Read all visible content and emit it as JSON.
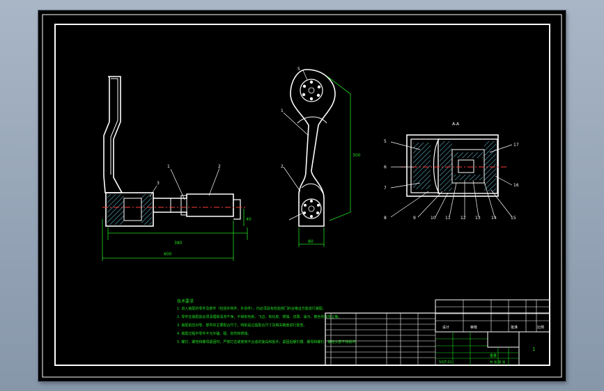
{
  "drawing": {
    "background": "#000000",
    "line_color": "#ffffff",
    "annotation_color": "#22e022",
    "centerline_color": "#ff3b3b"
  },
  "balloons": {
    "left_view": [
      "1",
      "2",
      "3"
    ],
    "middle_view": [
      "1",
      "2",
      "5"
    ],
    "right_view": [
      "5",
      "6",
      "7",
      "8",
      "9",
      "10",
      "11",
      "12",
      "13",
      "14",
      "15",
      "16",
      "17"
    ]
  },
  "dimensions": {
    "left_1": "380",
    "left_2": "600",
    "left_3": "40",
    "middle_1": "300",
    "middle_2": "80"
  },
  "notes": {
    "title": "技术要求",
    "lines": [
      "1. 进入装配的零件及部件（包括外购件、外协件），均必须具有检验部门的合格证方能进行装配。",
      "2. 零件在装配前必须清理和清洗干净，不得有毛刺、飞边、氧化皮、锈蚀、切屑、油污、着色剂和灰尘等。",
      "3. 装配前应对零、部件的主要配合尺寸，特别是过盈配合尺寸及相关精度进行复查。",
      "4. 装配过程中零件不允许磕、碰、划伤和锈蚀。",
      "5. 螺钉、螺栓和螺母紧固时，严禁打击或使用不合适的旋具和扳手，紧固后螺钉槽、螺母和螺钉、螺栓头部不得损坏。"
    ]
  },
  "title_block": {
    "sheet_number": "1",
    "drawing_number": "SXJT-01",
    "label_scale": "比例",
    "label_weight": "重量",
    "label_sheet": "共 张 第 张",
    "label_designer": "设计",
    "label_checker": "审核",
    "label_approver": "批准"
  }
}
